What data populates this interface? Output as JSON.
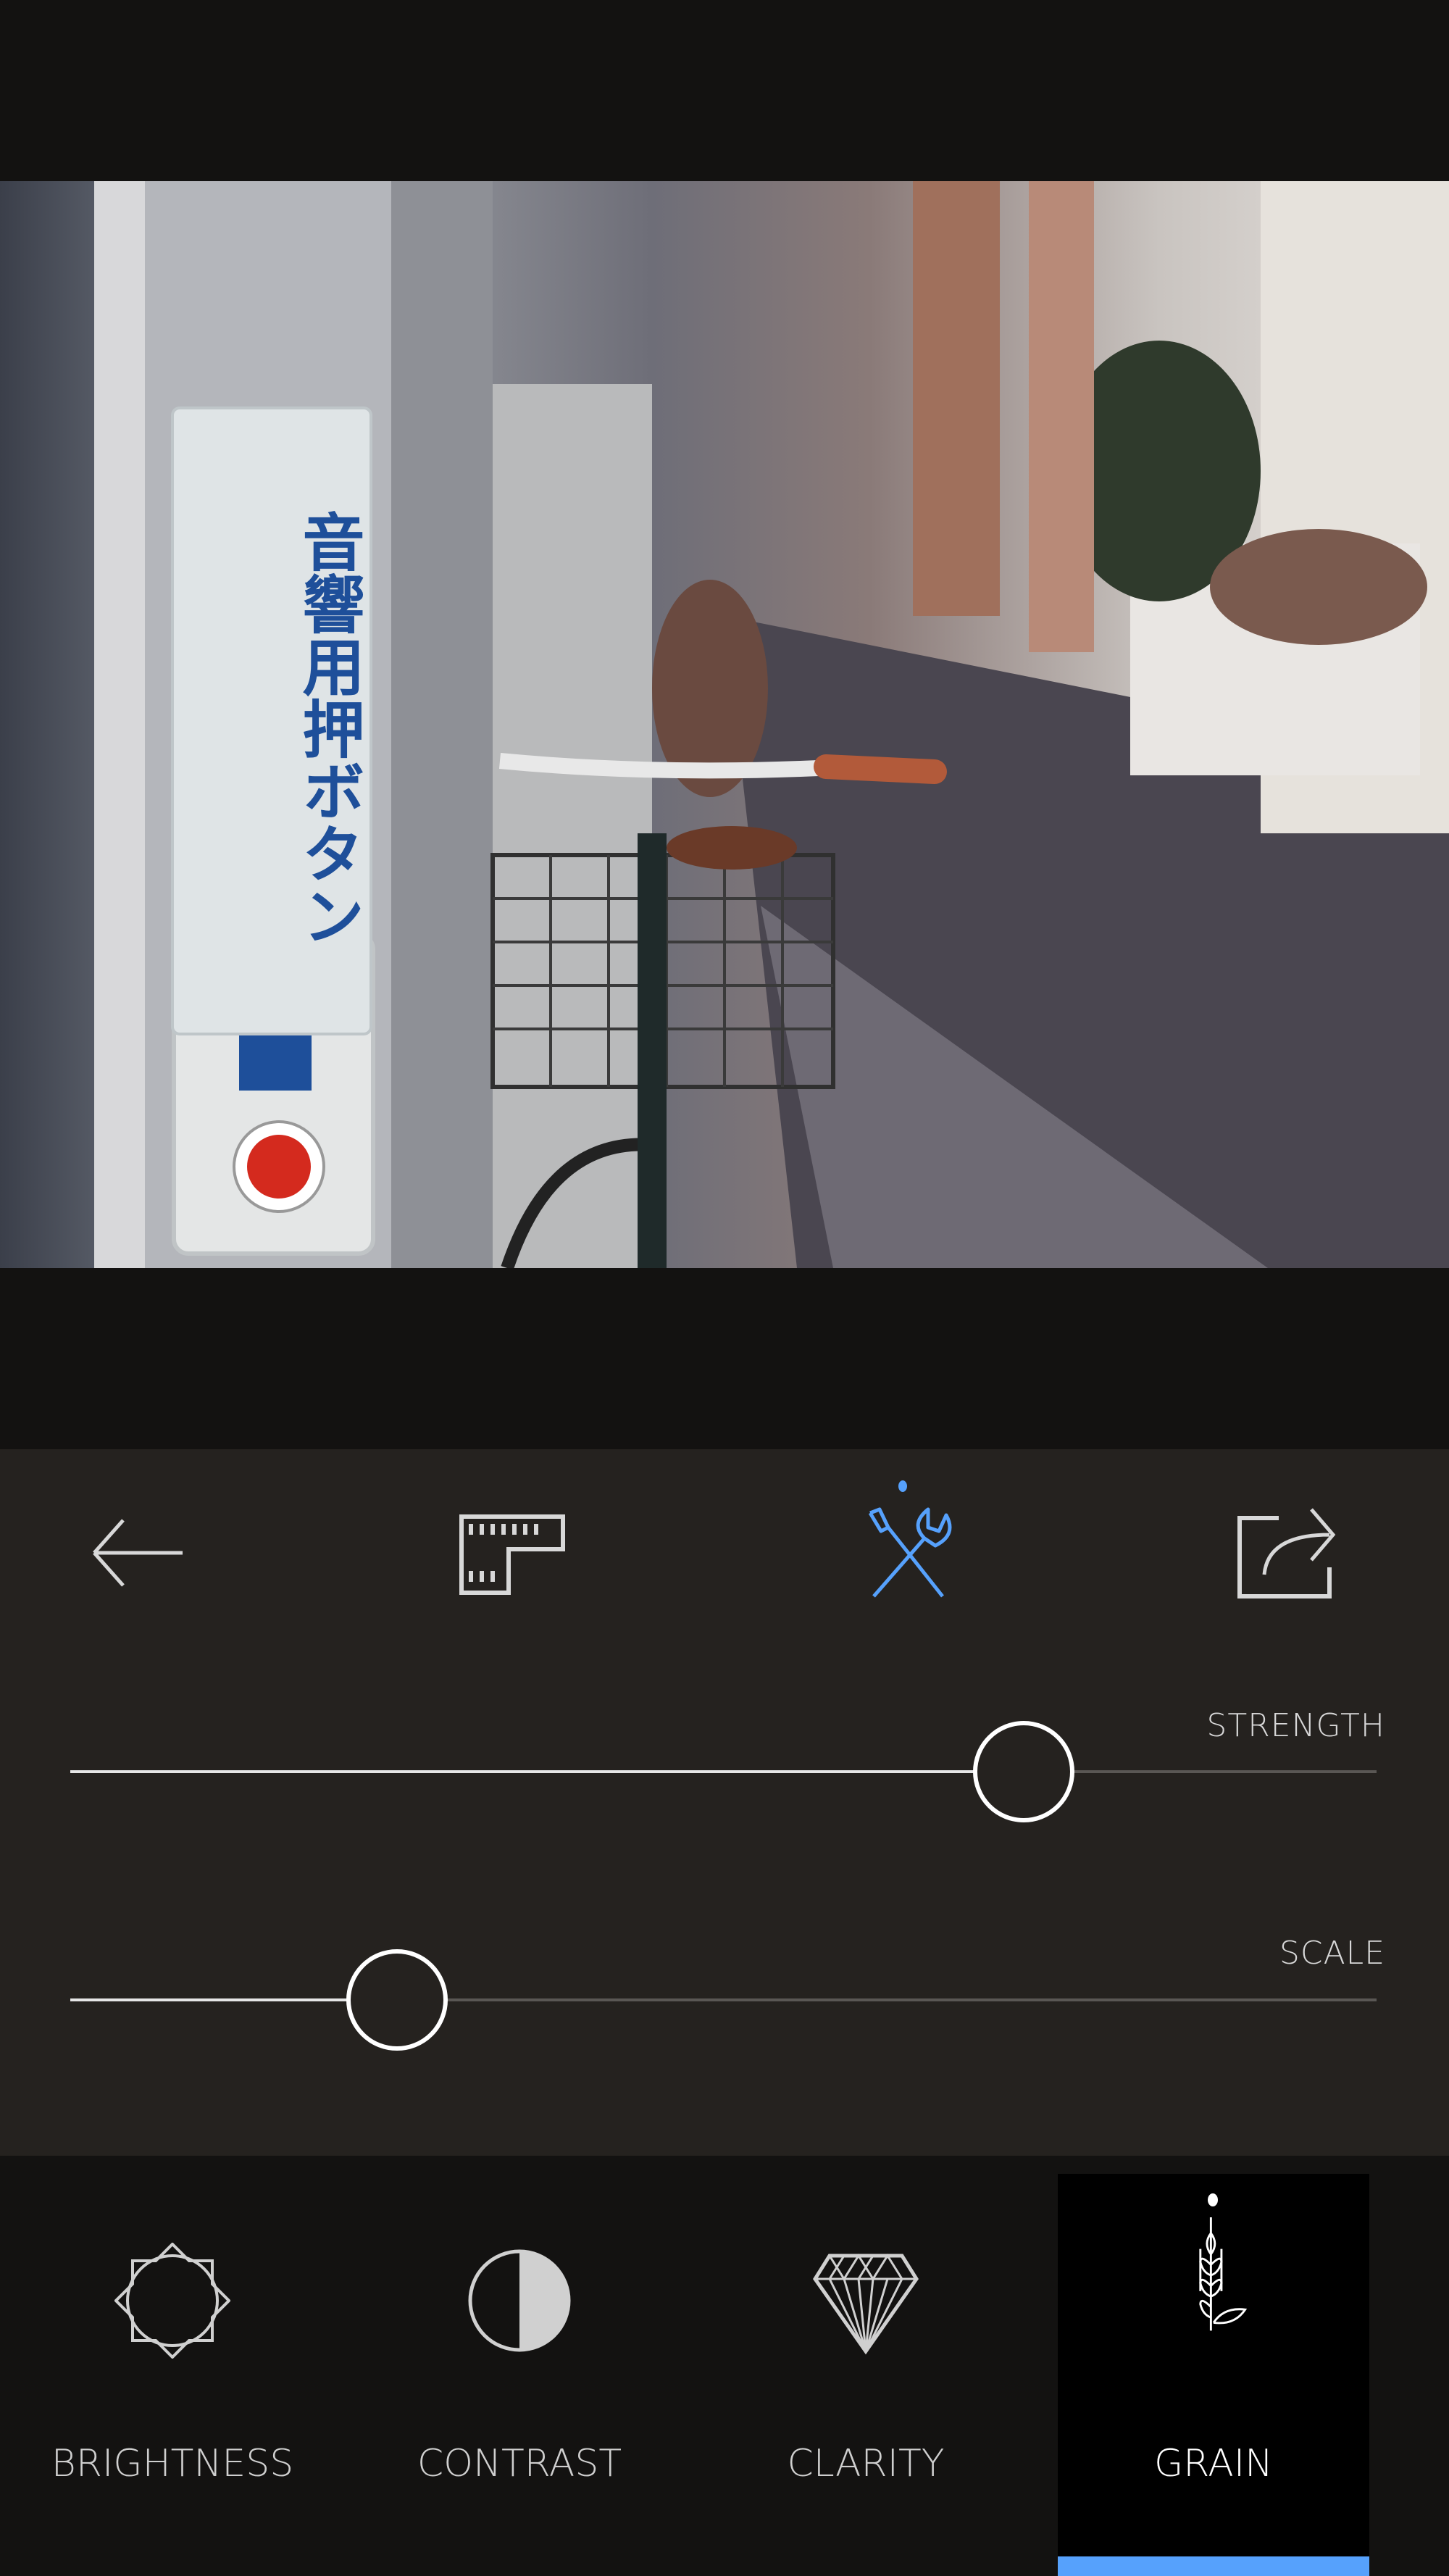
{
  "photo": {
    "sign_text": "音響用押ボタン"
  },
  "toolbar": {
    "items": [
      {
        "icon": "back-arrow-icon",
        "active": false
      },
      {
        "icon": "film-icon",
        "active": false
      },
      {
        "icon": "tools-icon",
        "active": true
      },
      {
        "icon": "share-icon",
        "active": false
      }
    ],
    "accent_color": "#56a1fc"
  },
  "sliders": [
    {
      "label": "STRENGTH",
      "value": 0.73
    },
    {
      "label": "SCALE",
      "value": 0.25
    }
  ],
  "tools": [
    {
      "label": "BRIGHTNESS",
      "icon": "sun-icon",
      "selected": false
    },
    {
      "label": "CONTRAST",
      "icon": "contrast-icon",
      "selected": false
    },
    {
      "label": "CLARITY",
      "icon": "diamond-icon",
      "selected": false
    },
    {
      "label": "GRAIN",
      "icon": "wheat-icon",
      "selected": true
    }
  ]
}
